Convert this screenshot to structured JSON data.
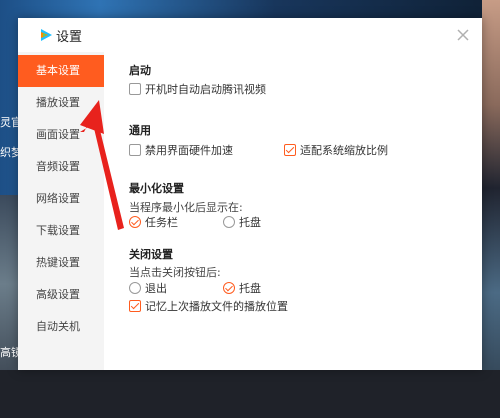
{
  "dialog": {
    "title": "设置",
    "accent_color": "#ff5c1f"
  },
  "sidebar": {
    "items": [
      {
        "label": "基本设置",
        "active": true
      },
      {
        "label": "播放设置",
        "active": false
      },
      {
        "label": "画面设置",
        "active": false
      },
      {
        "label": "音频设置",
        "active": false
      },
      {
        "label": "网络设置",
        "active": false
      },
      {
        "label": "下载设置",
        "active": false
      },
      {
        "label": "热键设置",
        "active": false
      },
      {
        "label": "高级设置",
        "active": false
      },
      {
        "label": "自动关机",
        "active": false
      }
    ]
  },
  "sections": {
    "startup": {
      "title": "启动",
      "auto_start": {
        "label": "开机时自动启动腾讯视频",
        "checked": false
      }
    },
    "general": {
      "title": "通用",
      "disable_hw_accel": {
        "label": "禁用界面硬件加速",
        "checked": false
      },
      "adapt_scaling": {
        "label": "适配系统缩放比例",
        "checked": true
      }
    },
    "minimize": {
      "title": "最小化设置",
      "prompt": "当程序最小化后显示在:",
      "taskbar": {
        "label": "任务栏",
        "selected": true
      },
      "tray": {
        "label": "托盘",
        "selected": false
      }
    },
    "close": {
      "title": "关闭设置",
      "prompt": "当点击关闭按钮后:",
      "exit": {
        "label": "退出",
        "selected": false
      },
      "tray": {
        "label": "托盘",
        "selected": true
      },
      "remember_position": {
        "label": "记忆上次播放文件的播放位置",
        "checked": true
      }
    }
  },
  "background": {
    "left_texts": [
      "灵官",
      "织梦",
      "高镜"
    ]
  },
  "icons": {
    "logo": "tencent-video-logo-icon",
    "close": "close-icon",
    "annotation": "red-arrow-annotation"
  }
}
